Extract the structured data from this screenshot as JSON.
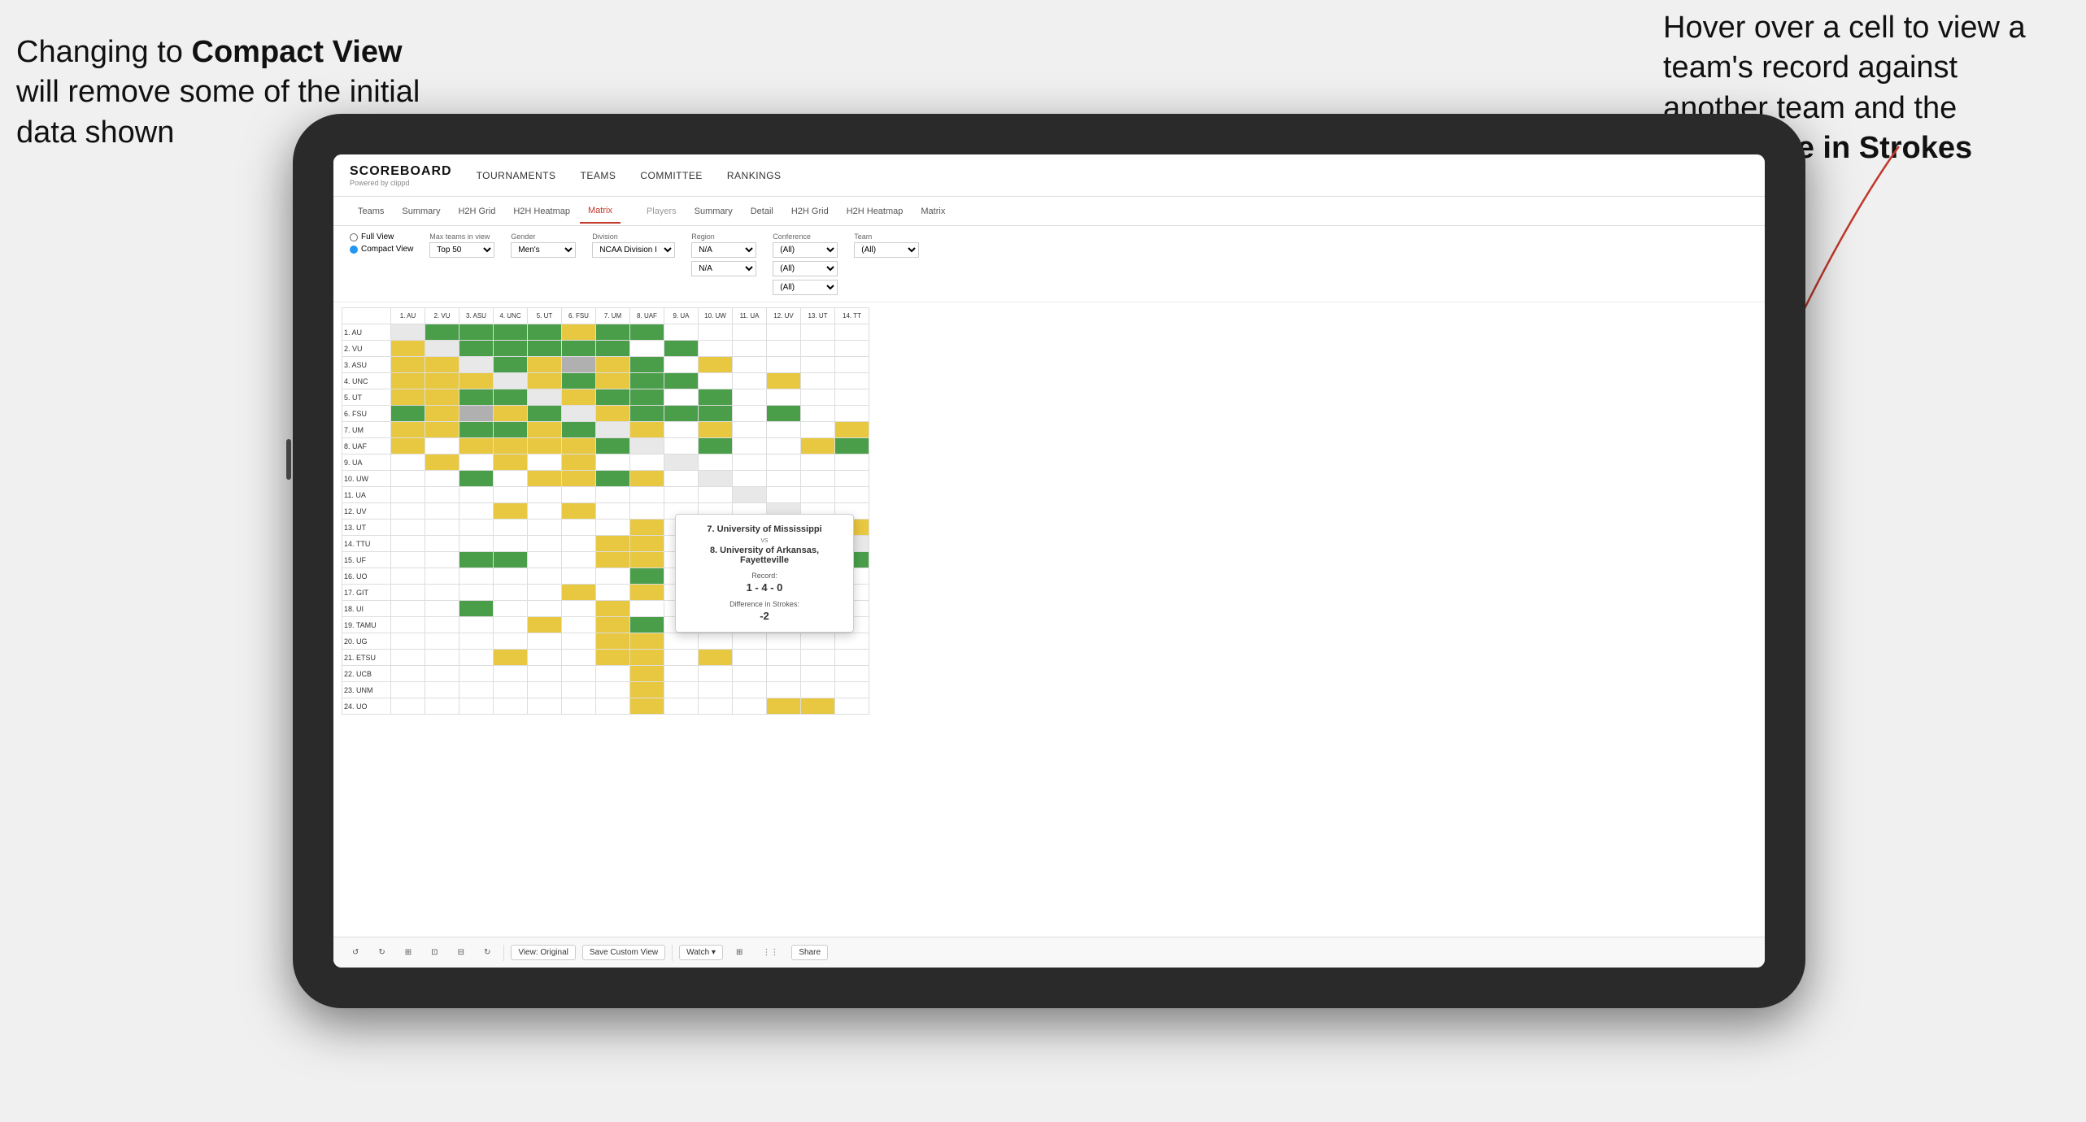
{
  "annotations": {
    "left_text": "Changing to Compact View will remove some of the initial data shown",
    "left_bold": "Compact View",
    "right_text": "Hover over a cell to view a team's record against another team and the Difference in Strokes",
    "right_bold": "Difference in Strokes"
  },
  "nav": {
    "logo": "SCOREBOARD",
    "logo_sub": "Powered by clippd",
    "items": [
      "TOURNAMENTS",
      "TEAMS",
      "COMMITTEE",
      "RANKINGS"
    ]
  },
  "sub_nav": {
    "teams_tabs": [
      "Teams",
      "Summary",
      "H2H Grid",
      "H2H Heatmap",
      "Matrix"
    ],
    "players_tabs": [
      "Players",
      "Summary",
      "Detail",
      "H2H Grid",
      "H2H Heatmap",
      "Matrix"
    ],
    "active": "Matrix"
  },
  "filters": {
    "view_options": [
      "Full View",
      "Compact View"
    ],
    "selected_view": "Compact View",
    "max_teams_label": "Max teams in view",
    "max_teams_value": "Top 50",
    "gender_label": "Gender",
    "gender_value": "Men's",
    "division_label": "Division",
    "division_value": "NCAA Division I",
    "region_label": "Region",
    "region_value": "N/A",
    "conference_label": "Conference",
    "conference_values": [
      "(All)",
      "(All)",
      "(All)"
    ],
    "team_label": "Team",
    "team_value": "(All)"
  },
  "matrix": {
    "col_headers": [
      "1. AU",
      "2. VU",
      "3. ASU",
      "4. UNC",
      "5. UT",
      "6. FSU",
      "7. UM",
      "8. UAF",
      "9. UA",
      "10. UW",
      "11. UA",
      "12. UV",
      "13. UT",
      "14. TT"
    ],
    "rows": [
      {
        "label": "1. AU",
        "cells": [
          "self",
          "green",
          "green",
          "green",
          "green",
          "yellow",
          "green",
          "green",
          "white",
          "white",
          "white",
          "white",
          "white",
          "white"
        ]
      },
      {
        "label": "2. VU",
        "cells": [
          "yellow",
          "self",
          "green",
          "green",
          "green",
          "green",
          "green",
          "white",
          "green",
          "white",
          "white",
          "white",
          "white",
          "white"
        ]
      },
      {
        "label": "3. ASU",
        "cells": [
          "yellow",
          "yellow",
          "self",
          "green",
          "yellow",
          "gray",
          "yellow",
          "green",
          "white",
          "yellow",
          "white",
          "white",
          "white",
          "white"
        ]
      },
      {
        "label": "4. UNC",
        "cells": [
          "yellow",
          "yellow",
          "yellow",
          "self",
          "yellow",
          "green",
          "yellow",
          "green",
          "green",
          "white",
          "white",
          "yellow",
          "white",
          "white"
        ]
      },
      {
        "label": "5. UT",
        "cells": [
          "yellow",
          "yellow",
          "green",
          "green",
          "self",
          "yellow",
          "green",
          "green",
          "white",
          "green",
          "white",
          "white",
          "white",
          "white"
        ]
      },
      {
        "label": "6. FSU",
        "cells": [
          "green",
          "yellow",
          "gray",
          "yellow",
          "green",
          "self",
          "yellow",
          "green",
          "green",
          "green",
          "white",
          "green",
          "white",
          "white"
        ]
      },
      {
        "label": "7. UM",
        "cells": [
          "yellow",
          "yellow",
          "green",
          "green",
          "yellow",
          "green",
          "self",
          "yellow",
          "white",
          "yellow",
          "white",
          "white",
          "white",
          "yellow"
        ]
      },
      {
        "label": "8. UAF",
        "cells": [
          "yellow",
          "white",
          "yellow",
          "yellow",
          "yellow",
          "yellow",
          "green",
          "self",
          "white",
          "green",
          "white",
          "white",
          "yellow",
          "green"
        ]
      },
      {
        "label": "9. UA",
        "cells": [
          "white",
          "yellow",
          "white",
          "yellow",
          "white",
          "yellow",
          "white",
          "white",
          "self",
          "white",
          "white",
          "white",
          "white",
          "white"
        ]
      },
      {
        "label": "10. UW",
        "cells": [
          "white",
          "white",
          "green",
          "white",
          "yellow",
          "yellow",
          "green",
          "yellow",
          "white",
          "self",
          "white",
          "white",
          "white",
          "white"
        ]
      },
      {
        "label": "11. UA",
        "cells": [
          "white",
          "white",
          "white",
          "white",
          "white",
          "white",
          "white",
          "white",
          "white",
          "white",
          "self",
          "white",
          "white",
          "white"
        ]
      },
      {
        "label": "12. UV",
        "cells": [
          "white",
          "white",
          "white",
          "yellow",
          "white",
          "yellow",
          "white",
          "white",
          "white",
          "white",
          "white",
          "self",
          "white",
          "white"
        ]
      },
      {
        "label": "13. UT",
        "cells": [
          "white",
          "white",
          "white",
          "white",
          "white",
          "white",
          "white",
          "yellow",
          "white",
          "white",
          "white",
          "white",
          "self",
          "yellow"
        ]
      },
      {
        "label": "14. TTU",
        "cells": [
          "white",
          "white",
          "white",
          "white",
          "white",
          "white",
          "yellow",
          "yellow",
          "white",
          "white",
          "white",
          "yellow",
          "yellow",
          "self"
        ]
      },
      {
        "label": "15. UF",
        "cells": [
          "white",
          "white",
          "green",
          "green",
          "white",
          "white",
          "yellow",
          "yellow",
          "white",
          "white",
          "white",
          "white",
          "yellow",
          "green"
        ]
      },
      {
        "label": "16. UO",
        "cells": [
          "white",
          "white",
          "white",
          "white",
          "white",
          "white",
          "white",
          "green",
          "white",
          "yellow",
          "white",
          "white",
          "white",
          "white"
        ]
      },
      {
        "label": "17. GIT",
        "cells": [
          "white",
          "white",
          "white",
          "white",
          "white",
          "yellow",
          "white",
          "yellow",
          "white",
          "white",
          "white",
          "white",
          "white",
          "white"
        ]
      },
      {
        "label": "18. UI",
        "cells": [
          "white",
          "white",
          "green",
          "white",
          "white",
          "white",
          "yellow",
          "white",
          "white",
          "white",
          "white",
          "white",
          "white",
          "white"
        ]
      },
      {
        "label": "19. TAMU",
        "cells": [
          "white",
          "white",
          "white",
          "white",
          "yellow",
          "white",
          "yellow",
          "green",
          "white",
          "yellow",
          "white",
          "white",
          "white",
          "white"
        ]
      },
      {
        "label": "20. UG",
        "cells": [
          "white",
          "white",
          "white",
          "white",
          "white",
          "white",
          "yellow",
          "yellow",
          "white",
          "white",
          "white",
          "white",
          "white",
          "white"
        ]
      },
      {
        "label": "21. ETSU",
        "cells": [
          "white",
          "white",
          "white",
          "yellow",
          "white",
          "white",
          "yellow",
          "yellow",
          "white",
          "yellow",
          "white",
          "white",
          "white",
          "white"
        ]
      },
      {
        "label": "22. UCB",
        "cells": [
          "white",
          "white",
          "white",
          "white",
          "white",
          "white",
          "white",
          "yellow",
          "white",
          "white",
          "white",
          "white",
          "white",
          "white"
        ]
      },
      {
        "label": "23. UNM",
        "cells": [
          "white",
          "white",
          "white",
          "white",
          "white",
          "white",
          "white",
          "yellow",
          "white",
          "white",
          "white",
          "white",
          "white",
          "white"
        ]
      },
      {
        "label": "24. UO",
        "cells": [
          "white",
          "white",
          "white",
          "white",
          "white",
          "white",
          "white",
          "yellow",
          "white",
          "white",
          "white",
          "yellow",
          "yellow",
          "white"
        ]
      }
    ]
  },
  "tooltip": {
    "team1": "7. University of Mississippi",
    "vs": "vs",
    "team2": "8. University of Arkansas, Fayetteville",
    "record_label": "Record:",
    "record": "1 - 4 - 0",
    "diff_label": "Difference in Strokes:",
    "diff": "-2"
  },
  "toolbar": {
    "buttons": [
      "↺",
      "→",
      "⊞",
      "⊡",
      "⊟",
      "↻"
    ],
    "view_btn": "View: Original",
    "save_btn": "Save Custom View",
    "watch_btn": "Watch ▾",
    "share_btn": "Share",
    "icon_buttons": [
      "⊞",
      "⋮⋮"
    ]
  }
}
